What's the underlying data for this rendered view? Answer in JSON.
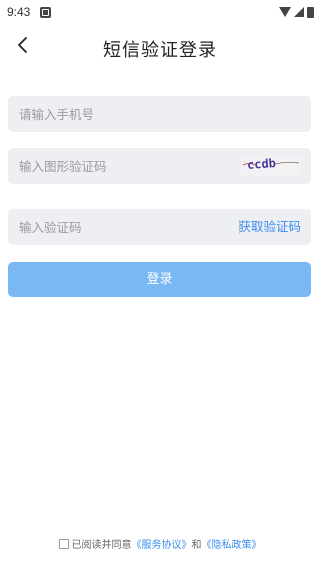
{
  "status_bar": {
    "time": "9:43"
  },
  "header": {
    "title": "短信验证登录"
  },
  "form": {
    "phone_placeholder": "请输入手机号",
    "captcha_placeholder": "输入图形验证码",
    "captcha_text": "ccdb",
    "code_placeholder": "输入验证码",
    "get_code_label": "获取验证码",
    "login_label": "登录"
  },
  "agreement": {
    "prefix": "已阅读并同意",
    "service_link": "《服务协议》",
    "conjunction": "和",
    "privacy_link": "《隐私政策》"
  },
  "colors": {
    "accent": "#3b8ef0",
    "login_button": "#79b7f5",
    "field_background": "#eeeff3"
  },
  "icons": {
    "back": "chevron-left-icon",
    "notification": "notification-icon",
    "wifi": "wifi-icon",
    "signal": "signal-icon",
    "battery": "battery-icon"
  }
}
